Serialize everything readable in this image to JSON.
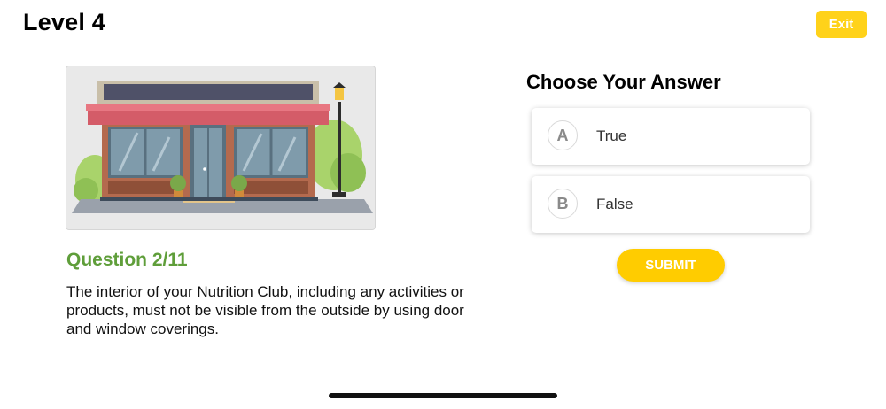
{
  "header": {
    "level_title": "Level 4",
    "exit_label": "Exit"
  },
  "question": {
    "number_label": "Question 2/11",
    "text": "The interior of your Nutrition Club, including any activities or products, must not be visible from the outside by using door and window coverings."
  },
  "answers": {
    "heading": "Choose Your Answer",
    "options": [
      {
        "letter": "A",
        "label": "True"
      },
      {
        "letter": "B",
        "label": "False"
      }
    ],
    "submit_label": "SUBMIT"
  },
  "colors": {
    "accent": "#ffcc00",
    "question_green": "#5f9e3a",
    "awning": "#d95a66"
  }
}
